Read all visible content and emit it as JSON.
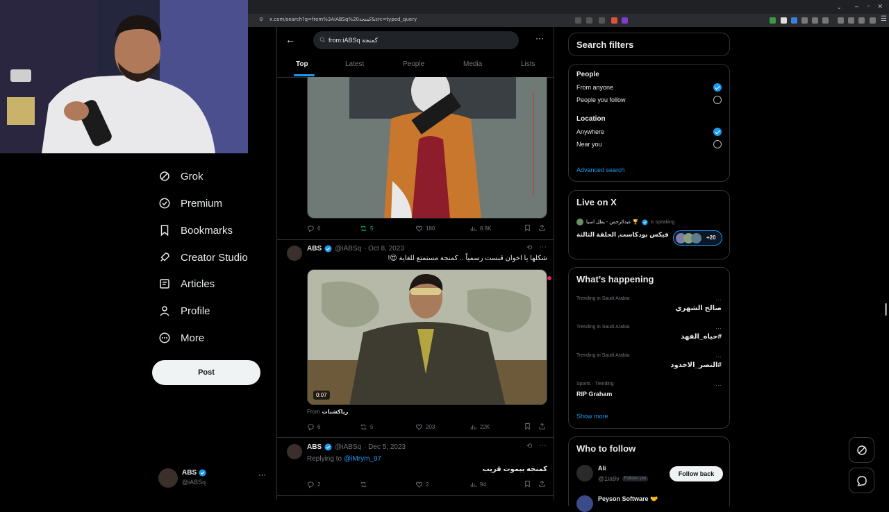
{
  "browser": {
    "url": "x.com/search?q=from%3AiABSq%20كمنجة&src=typed_query"
  },
  "nav": {
    "items": [
      {
        "label": "Grok",
        "icon": "grok-icon"
      },
      {
        "label": "Premium",
        "icon": "premium-icon"
      },
      {
        "label": "Bookmarks",
        "icon": "bookmark-icon"
      },
      {
        "label": "Creator Studio",
        "icon": "rocket-icon"
      },
      {
        "label": "Articles",
        "icon": "article-icon"
      },
      {
        "label": "Profile",
        "icon": "person-icon"
      },
      {
        "label": "More",
        "icon": "more-circle-icon"
      }
    ],
    "post_label": "Post",
    "account": {
      "name": "ABS",
      "handle": "@iABSq",
      "menu": "···"
    }
  },
  "search": {
    "query": "from:iABSq كمنجة",
    "tabs": [
      "Top",
      "Latest",
      "People",
      "Media",
      "Lists"
    ]
  },
  "tweets": [
    {
      "stats": {
        "replies": "6",
        "reposts": "5",
        "likes": "180",
        "views": "8.8K"
      }
    },
    {
      "name": "ABS",
      "handle": "@iABSq",
      "date": "· Oct 8, 2023",
      "text": "شكلها يا اخوان قبست رسمياً .. كمنجة مستمتع للغاية 😍!",
      "video_time": "0:07",
      "from_label": "From",
      "from_source": "رياكشنات",
      "stats": {
        "replies": "6",
        "reposts": "5",
        "likes": "203",
        "views": "22K"
      }
    },
    {
      "name": "ABS",
      "handle": "@iABSq",
      "date": "· Dec 5, 2023",
      "replying_label": "Replying to",
      "replying_to": "@iMrym_97",
      "text": "كمنجه بيموت قريب",
      "stats": {
        "replies": "2",
        "reposts": "",
        "likes": "2",
        "views": "94"
      }
    }
  ],
  "filters": {
    "title": "Search filters",
    "people_heading": "People",
    "people_options": [
      "From anyone",
      "People you follow"
    ],
    "location_heading": "Location",
    "location_options": [
      "Anywhere",
      "Near you"
    ],
    "advanced": "Advanced search"
  },
  "live": {
    "title": "Live on X",
    "host": "عبدالرحمن - بطل اسيا 🏆",
    "speaking": "is speaking",
    "space_title": "فيكس بودكاست, الحلقة الثالثة",
    "listeners": "+20"
  },
  "happening": {
    "title": "What’s happening",
    "trends": [
      {
        "context": "Trending in Saudi Arabia",
        "topic": "صالح الشهري"
      },
      {
        "context": "Trending in Saudi Arabia",
        "topic": "#حياه_الفهد"
      },
      {
        "context": "Trending in Saudi Arabia",
        "topic": "#النصر_الاخدود"
      },
      {
        "context": "Sports · Trending",
        "topic": "RIP Graham"
      }
    ],
    "show_more": "Show more"
  },
  "who_to_follow": {
    "title": "Who to follow",
    "user": {
      "name": "Ali",
      "handle": "@1ia9v",
      "badge": "Follows you",
      "button": "Follow back"
    },
    "next_user": "Peyson Software 🤝"
  },
  "colors": {
    "accent": "#1d9bf0",
    "repost_green": "#00ba7c",
    "bg": "#000000"
  }
}
